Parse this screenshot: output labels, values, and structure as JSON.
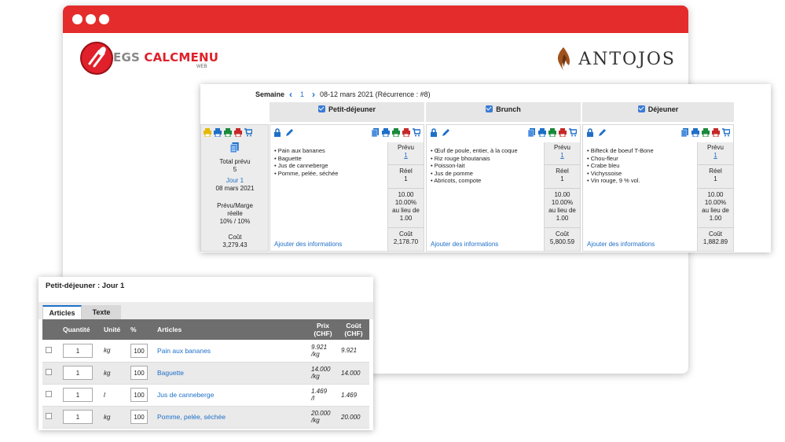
{
  "branding": {
    "app_name_a": "EGS",
    "app_name_b": "CALCMENU",
    "app_sub": "WEB",
    "client": "Antojos",
    "client_display": "ANTOJOS"
  },
  "colors": {
    "brand_red": "#e42c2c",
    "link_blue": "#1e6fc8"
  },
  "planning": {
    "week_label": "Semaine",
    "week_num": "1",
    "week_range": "08-12 mars 2021 (Récurrence : #8)",
    "summary": {
      "total_label": "Total prévu",
      "total_value": "5",
      "day_link": "Jour 1",
      "date": "08 mars 2021",
      "margin_label_1": "Prévu/Marge",
      "margin_label_2": "réelle",
      "margin_value": "10% / 10%",
      "cost_label": "Coût",
      "cost_value": "3,279.43"
    },
    "meals": [
      {
        "name": "Petit-déjeuner",
        "items": [
          "Pain aux bananes",
          "Baguette",
          "Jus de canneberge",
          "Pomme, pelée, séchée"
        ],
        "planned_label": "Prévu",
        "planned": "1",
        "actual_label": "Réel",
        "actual": "1",
        "figure": "10.00",
        "pct": "10.00%",
        "instead_of_1": "au lieu de",
        "instead_val": "1.00",
        "cost_label": "Coût",
        "cost": "2,178.70",
        "add_info": "Ajouter des informations"
      },
      {
        "name": "Brunch",
        "items": [
          "Œuf de poule, entier, à la coque",
          "Riz rouge bhoutanais",
          "Poisson-lait",
          "Jus de pomme",
          "Abricots, compote"
        ],
        "planned_label": "Prévu",
        "planned": "1",
        "actual_label": "Réel",
        "actual": "1",
        "figure": "10.00",
        "pct": "10.00%",
        "instead_of_1": "au lieu de",
        "instead_val": "1.00",
        "cost_label": "Coût",
        "cost": "5,800.59",
        "add_info": "Ajouter des informations"
      },
      {
        "name": "Déjeuner",
        "items": [
          "Bifteck de boeuf T-Bone",
          "Chou-fleur",
          "Crabe bleu",
          "Vichyssoise",
          "Vin rouge, 9 % vol."
        ],
        "planned_label": "Prévu",
        "planned": "1",
        "actual_label": "Réel",
        "actual": "1",
        "figure": "10.00",
        "pct": "10.00%",
        "instead_of_1": "au lieu de",
        "instead_val": "1.00",
        "cost_label": "Coût",
        "cost": "1,882.89",
        "add_info": "Ajouter des informations"
      }
    ]
  },
  "detail": {
    "title": "Petit-déjeuner : Jour 1",
    "tabs": [
      "Articles",
      "Texte"
    ],
    "headers": {
      "quantity": "Quantité",
      "unit": "Unité",
      "pct": "%",
      "articles": "Articles",
      "price_1": "Prix",
      "price_2": "(CHF)",
      "cost_1": "Coût",
      "cost_2": "(CHF)"
    },
    "rows": [
      {
        "qty": "1",
        "unit": "kg",
        "pct": "100",
        "name": "Pain aux bananes",
        "price_1": "9.921",
        "price_2": "/kg",
        "cost": "9.921"
      },
      {
        "qty": "1",
        "unit": "kg",
        "pct": "100",
        "name": "Baguette",
        "price_1": "14.000",
        "price_2": "/kg",
        "cost": "14.000"
      },
      {
        "qty": "1",
        "unit": "l",
        "pct": "100",
        "name": "Jus de canneberge",
        "price_1": "1.469",
        "price_2": "/l",
        "cost": "1.469"
      },
      {
        "qty": "1",
        "unit": "kg",
        "pct": "100",
        "name": "Pomme, pelée, séchée",
        "price_1": "20.000",
        "price_2": "/kg",
        "cost": "20.000"
      }
    ]
  }
}
